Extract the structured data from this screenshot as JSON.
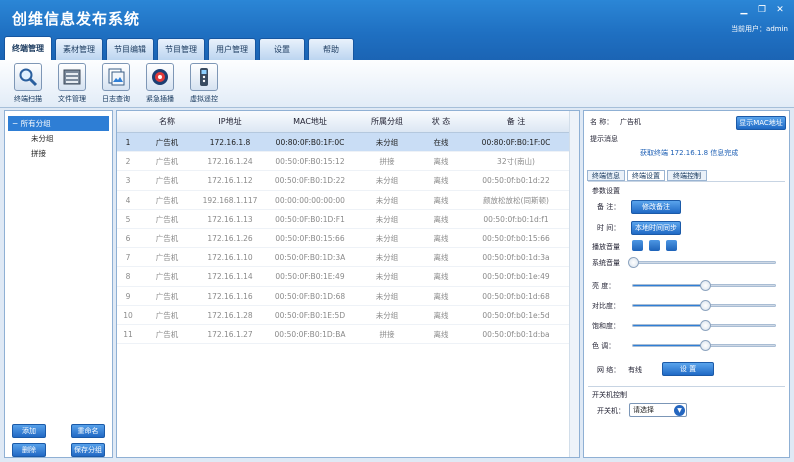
{
  "app": {
    "title": "创维信息发布系统",
    "current_user": "当前用户：admin"
  },
  "tabs": [
    "终端管理",
    "素材管理",
    "节目编辑",
    "节目管理",
    "用户管理",
    "设置",
    "帮助"
  ],
  "toolbar": [
    "终端扫描",
    "文件管理",
    "日志查询",
    "紧急插播",
    "虚拟遥控"
  ],
  "left": {
    "root": "所有分组",
    "children": [
      "未分组",
      "拼接"
    ],
    "buttons": {
      "add": "添加",
      "rename": "重命名",
      "delete": "删除",
      "save": "保存分组"
    }
  },
  "table": {
    "headers": [
      "名称",
      "IP地址",
      "MAC地址",
      "所属分组",
      "状 态",
      "备 注"
    ],
    "rows": [
      [
        "1",
        "广告机",
        "172.16.1.8",
        "00:80:0F:B0:1F:0C",
        "未分组",
        "在线",
        "00:80:0F:B0:1F:0C"
      ],
      [
        "2",
        "广告机",
        "172.16.1.24",
        "00:50:0F:B0:15:12",
        "拼接",
        "离线",
        "32寸(南山)"
      ],
      [
        "3",
        "广告机",
        "172.16.1.12",
        "00:50:0F:B0:1D:22",
        "未分组",
        "离线",
        "00:50:0f:b0:1d:22"
      ],
      [
        "4",
        "广告机",
        "192.168.1.117",
        "00:00:00:00:00:00",
        "未分组",
        "离线",
        "颜放松放松(同斯顿)"
      ],
      [
        "5",
        "广告机",
        "172.16.1.13",
        "00:50:0F:B0:1D:F1",
        "未分组",
        "离线",
        "00:50:0f:b0:1d:f1"
      ],
      [
        "6",
        "广告机",
        "172.16.1.26",
        "00:50:0F:B0:15:66",
        "未分组",
        "离线",
        "00:50:0f:b0:15:66"
      ],
      [
        "7",
        "广告机",
        "172.16.1.10",
        "00:50:0F:B0:1D:3A",
        "未分组",
        "离线",
        "00:50:0f:b0:1d:3a"
      ],
      [
        "8",
        "广告机",
        "172.16.1.14",
        "00:50:0F:B0:1E:49",
        "未分组",
        "离线",
        "00:50:0f:b0:1e:49"
      ],
      [
        "9",
        "广告机",
        "172.16.1.16",
        "00:50:0F:B0:1D:68",
        "未分组",
        "离线",
        "00:50:0f:b0:1d:68"
      ],
      [
        "10",
        "广告机",
        "172.16.1.28",
        "00:50:0F:B0:1E:5D",
        "未分组",
        "离线",
        "00:50:0f:b0:1e:5d"
      ],
      [
        "11",
        "广告机",
        "172.16.1.27",
        "00:50:0F:B0:1D:BA",
        "拼接",
        "离线",
        "00:50:0f:b0:1d:ba"
      ]
    ]
  },
  "right": {
    "name_label": "名 称：",
    "name_value": "广告机",
    "show_mac_button": "显示MAC地址",
    "prompt_label": "提示消息",
    "prompt_message": "获取终端 172.16.1.8 信息完成",
    "tabs": [
      "终端信息",
      "终端设置",
      "终端控制"
    ],
    "params_title": "参数设置",
    "remark_label": "备 注：",
    "remark_button": "修改备注",
    "time_label": "时 间：",
    "time_button": "本地时间同步",
    "volume_label": "播放音量",
    "sliders": [
      {
        "label": "系统音量",
        "value": 0
      },
      {
        "label": "亮 度：",
        "value": 50
      },
      {
        "label": "对比度：",
        "value": 50
      },
      {
        "label": "饱和度：",
        "value": 50
      },
      {
        "label": "色 调：",
        "value": 50
      }
    ],
    "network_label": "网 络：",
    "network_value": "有线",
    "network_button": "设 置",
    "power_title": "开关机控制",
    "power_label": "开关机：",
    "power_placeholder": "请选择"
  }
}
